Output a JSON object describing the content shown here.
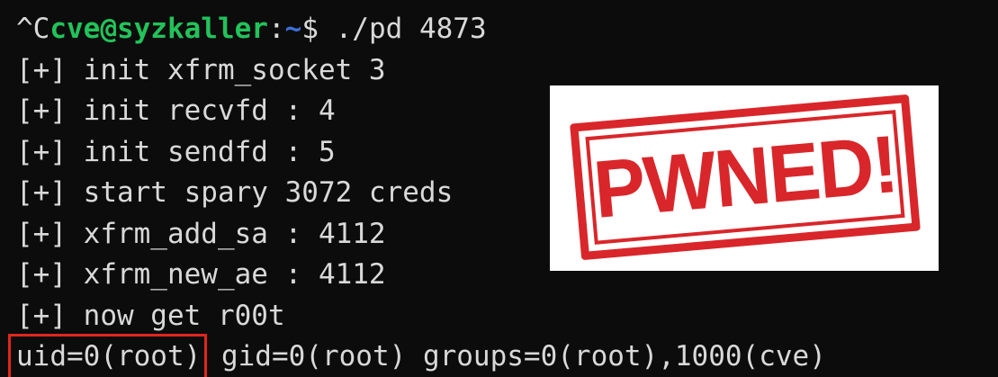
{
  "terminal": {
    "prompt": {
      "interrupt": "^C",
      "user_host": "cve@syzkaller",
      "colon": ":",
      "path": "~",
      "symbol": "$",
      "command": " ./pd 4873"
    },
    "lines": [
      "[+] init xfrm_socket 3",
      "[+] init recvfd : 4",
      "[+] init sendfd : 5",
      "[+] start spary 3072 creds",
      "[+] xfrm_add_sa : 4112",
      "[+] xfrm_new_ae : 4112",
      "[+] now get r00t"
    ],
    "id_output": {
      "uid": "uid=0(root)",
      "rest": " gid=0(root) groups=0(root),1000(cve)"
    }
  },
  "overlay": {
    "stamp_text": "PWNED!",
    "stamp_color": "#d9262a",
    "highlight_color": "#e0261d"
  },
  "colors": {
    "background": "#0c0c0c",
    "text": "#d9d9d9",
    "user_host": "#22c35a",
    "path": "#3b6fd8"
  }
}
